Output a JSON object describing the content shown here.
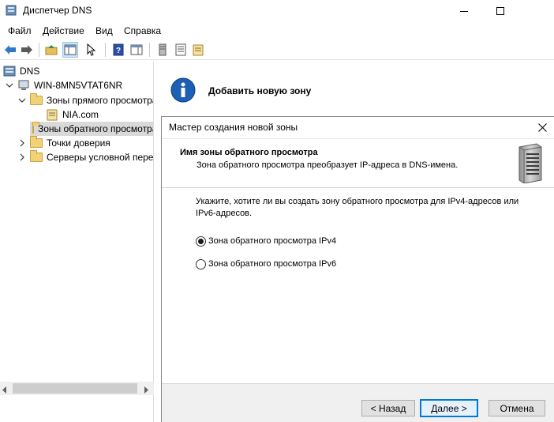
{
  "window": {
    "title": "Диспетчер DNS"
  },
  "menu": [
    "Файл",
    "Действие",
    "Вид",
    "Справка"
  ],
  "tree": {
    "root": "DNS",
    "server": "WIN-8MN5VTAT6NR",
    "forward_zones": "Зоны прямого просмотра",
    "forward_zone_item": "NIA.com",
    "reverse_zones": "Зоны обратного просмотра",
    "trust_points": "Точки доверия",
    "conditional_forwarders": "Серверы условной пересылки"
  },
  "right_pane": {
    "action_title": "Добавить новую зону"
  },
  "wizard": {
    "title": "Мастер создания новой зоны",
    "heading": "Имя зоны обратного просмотра",
    "subheading": "Зона обратного просмотра преобразует IP-адреса в DNS-имена.",
    "prompt_line1": "Укажите, хотите ли вы создать зону обратного просмотра для IPv4-адресов или",
    "prompt_line2": "IPv6-адресов.",
    "options": [
      {
        "label": "Зона обратного просмотра IPv4",
        "selected": true
      },
      {
        "label": "Зона обратного просмотра IPv6",
        "selected": false
      }
    ],
    "buttons": {
      "back": "< Назад",
      "next": "Далее >",
      "cancel": "Отмена"
    }
  },
  "colors": {
    "accent": "#0078d7",
    "folder": "#f2d279",
    "selection": "#d9d9d9"
  }
}
